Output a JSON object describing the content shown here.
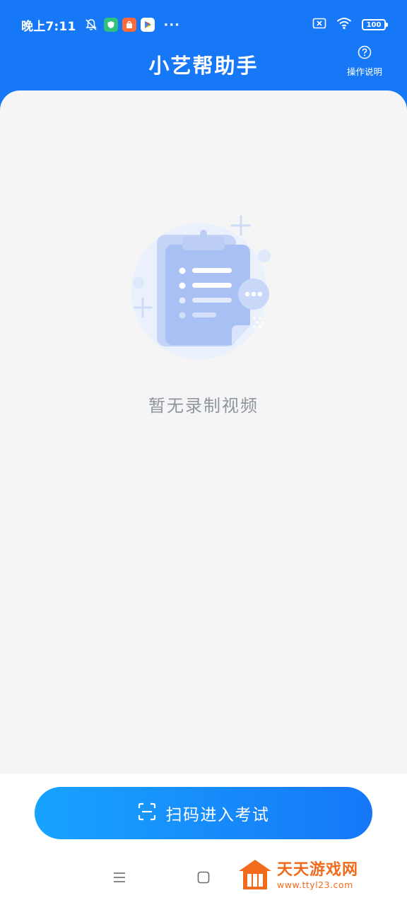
{
  "status_bar": {
    "time": "晚上7:11",
    "more": "···",
    "battery": "100"
  },
  "header": {
    "title": "小艺帮助手",
    "help_label": "操作说明"
  },
  "empty_state": {
    "message": "暂无录制视频"
  },
  "footer": {
    "scan_button_label": "扫码进入考试"
  },
  "watermark": {
    "title": "天天游戏网",
    "url": "www.ttyl23.com"
  },
  "colors": {
    "primary": "#1677f7",
    "gradient_start": "#18a3ff",
    "panel_bg": "#f5f5f6",
    "empty_text": "#8f959e",
    "watermark": "#f26a1b"
  }
}
